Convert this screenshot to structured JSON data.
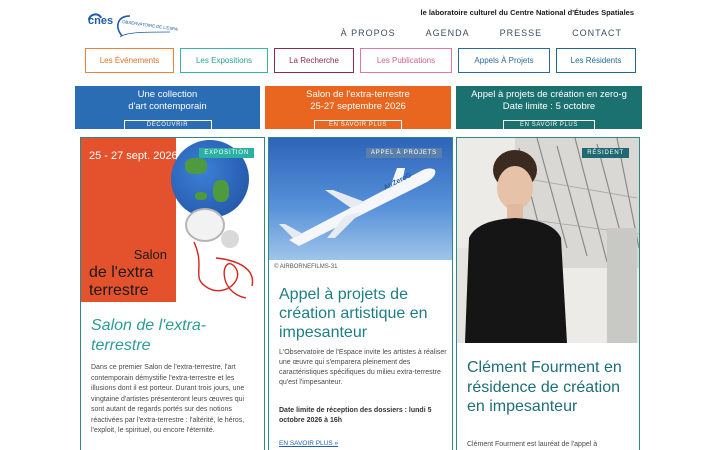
{
  "header": {
    "logo_text": "cnes",
    "logo_subtext": "OBSERVATOIRE DE L'ESPACE",
    "tagline": "le laboratoire culturel du Centre National d'Études Spatiales",
    "nav": [
      "À PROPOS",
      "AGENDA",
      "PRESSE",
      "CONTACT"
    ]
  },
  "categories": [
    {
      "label": "Les Événements",
      "color": "#e8833a"
    },
    {
      "label": "Les Expositions",
      "color": "#3bb2a8"
    },
    {
      "label": "La Recherche",
      "color": "#8b2b52"
    },
    {
      "label": "Les Publications",
      "color": "#e079a3"
    },
    {
      "label": "Appels À Projets",
      "color": "#2b6a9e"
    },
    {
      "label": "Les Résidents",
      "color": "#1e6a8e"
    }
  ],
  "banners": [
    {
      "title_1": "Une collection",
      "title_2": "d'art contemporain",
      "button": "DÉCOUVRIR",
      "color": "#2b6db5"
    },
    {
      "title_1": "Salon de l'extra-terrestre",
      "title_2": "25-27 septembre 2026",
      "button": "EN SAVOIR PLUS",
      "color": "#e8661f"
    },
    {
      "title_1": "Appel à projets de création en zero-g",
      "title_2": "Date limite : 5 octobre",
      "button": "EN SAVOIR PLUS",
      "color": "#1b7070"
    }
  ],
  "cards": [
    {
      "tag": "EXPOSITION",
      "tag_color": "#2bb0a4",
      "poster_date": "25 - 27 sept. 2026",
      "poster_title_1": "Salon",
      "poster_title_2": "de l'extra",
      "poster_title_3": "terrestre",
      "title": "Salon de l'extra-terrestre",
      "body": "Dans ce premier Salon de l'extra-terrestre, l'art contemporain démystifie l'extra-terrestre et les illusions dont il est porteur. Durant trois jours, une vingtaine d'artistes présenteront leurs œuvres qui sont autant de regards portés sur des notions réactivées par l'extra-terrestre : l'altérité, le héros, l'exploit, le spirituel, ou encore l'éternité."
    },
    {
      "tag": "APPEL À PROJETS",
      "tag_color": "#5a7fa8",
      "credit": "© AIRBORNEFILMS-31",
      "title": "Appel à projets de création artistique en impesanteur",
      "body": "L'Observatoire de l'Espace invite les artistes à réaliser une œuvre qui s'emparera pleinement des caractéristiques spécifiques du milieu extra-terrestre qu'est l'impesanteur.",
      "date": "Date limite de réception des dossiers : lundi 5 octobre 2026 à 16h",
      "more": "EN SAVOIR PLUS »",
      "plane_text": "AirZeroG"
    },
    {
      "tag": "RÉSIDENT",
      "tag_color": "#1f6a72",
      "title": "Clément Fourment en résidence de création en impesanteur",
      "body": "Clément Fourment est lauréat de l'appel à"
    }
  ]
}
